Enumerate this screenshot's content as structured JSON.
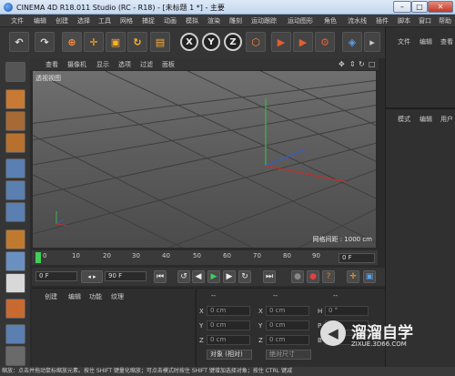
{
  "window": {
    "title": "CINEMA 4D R18.011 Studio (RC - R18) - [未标题 1 *] - 主要"
  },
  "menu": [
    "文件",
    "编辑",
    "创建",
    "选择",
    "工具",
    "网格",
    "捕捉",
    "动画",
    "模拟",
    "渲染",
    "雕刻",
    "运动跟踪",
    "运动图形",
    "角色",
    "流水线",
    "插件",
    "脚本",
    "窗口",
    "帮助"
  ],
  "toolbar": {
    "x_axis": "X",
    "y_axis": "Y",
    "z_axis": "Z"
  },
  "right_panel": {
    "top_tabs": [
      "文件",
      "编辑",
      "查看"
    ],
    "attr_tabs": [
      "模式",
      "编辑",
      "用户"
    ]
  },
  "viewport": {
    "menu": [
      "查看",
      "摄像机",
      "显示",
      "选项",
      "过滤",
      "面板"
    ],
    "label": "透视视图",
    "grid_scale": "网格间距 : 1000 cm"
  },
  "timeline": {
    "ticks": [
      "0",
      "10",
      "20",
      "30",
      "40",
      "50",
      "60",
      "70",
      "80",
      "90"
    ],
    "frame_box": "0 F"
  },
  "transport": {
    "start": "0 F",
    "end": "90 F"
  },
  "materials": {
    "tabs": [
      "创建",
      "编辑",
      "功能",
      "纹理"
    ]
  },
  "coordinates": {
    "header": [
      "--",
      "--",
      "--"
    ],
    "rows": [
      {
        "axis1": "X",
        "val1": "0 cm",
        "axis2": "X",
        "val2": "0 cm",
        "axis3": "H",
        "val3": "0 °"
      },
      {
        "axis1": "Y",
        "val1": "0 cm",
        "axis2": "Y",
        "val2": "0 cm",
        "axis3": "P",
        "val3": "0 °"
      },
      {
        "axis1": "Z",
        "val1": "0 cm",
        "axis2": "Z",
        "val2": "0 cm",
        "axis3": "B",
        "val3": "0 °"
      }
    ],
    "mode": "对象 (相对)",
    "size": "绝对尺寸"
  },
  "status": "缩放：点击并拖动鼠标缩放元素。按住 SHIFT 键量化缩放；可点击模式时按住 SHIFT 键增加选择对象；按住 CTRL 键减",
  "watermark": {
    "logo": "◀",
    "title": "溜溜自学",
    "url": "ZIXUE.3D66.COM"
  }
}
